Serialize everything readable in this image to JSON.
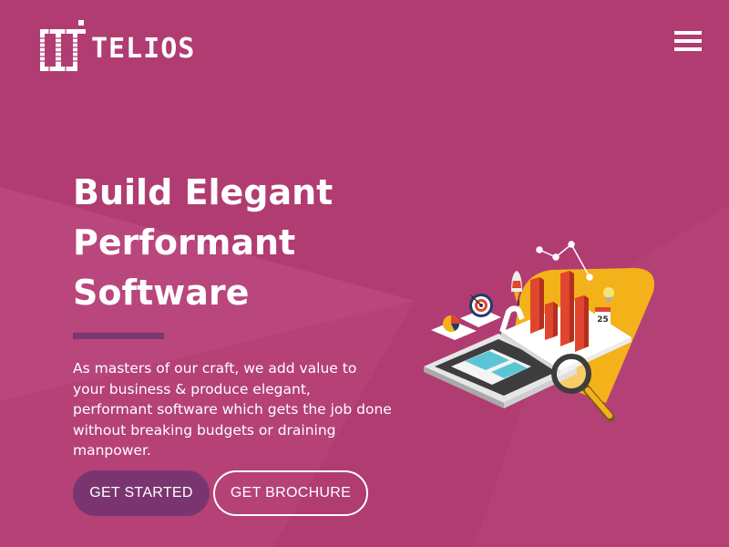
{
  "brand": {
    "name": "TELIOS"
  },
  "hero": {
    "title_lines": [
      "Build Elegant",
      "Performant",
      "Software"
    ],
    "description": "As masters of our craft, we add value to your business & produce elegant, performant software which gets the job done without breaking budgets or draining manpower."
  },
  "buttons": {
    "primary": "GET STARTED",
    "secondary": "GET BROCHURE"
  },
  "illustration": {
    "calendar_day": "25"
  },
  "icons": {
    "menu": "hamburger-menu-icon"
  },
  "colors": {
    "background": "#b03c72",
    "primary_button": "#7a3570",
    "divider": "#7a3573",
    "accent_yellow": "#f3b21a",
    "accent_red": "#e0452e"
  }
}
